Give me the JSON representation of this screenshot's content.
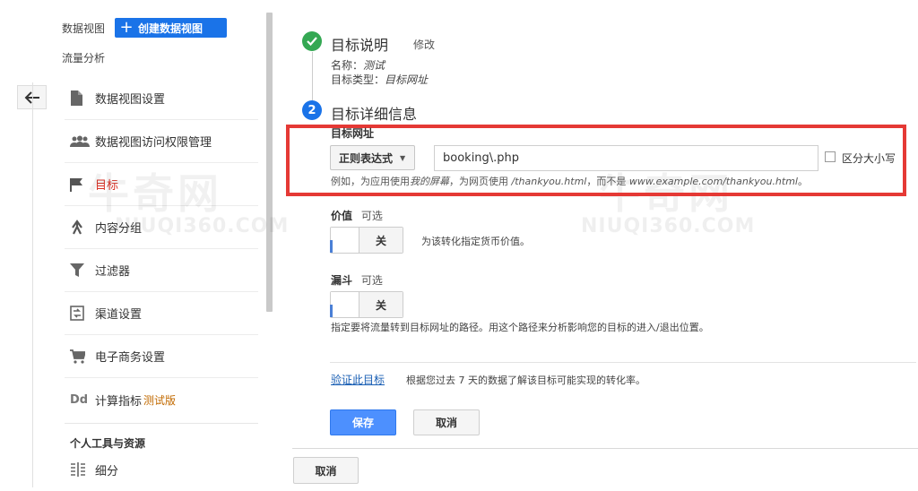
{
  "sidebar": {
    "view_label": "数据视图",
    "create_view_button": "创建数据视图",
    "section_title": "流量分析",
    "items": [
      {
        "label": "数据视图设置"
      },
      {
        "label": "数据视图访问权限管理"
      },
      {
        "label": "目标"
      },
      {
        "label": "内容分组"
      },
      {
        "label": "过滤器"
      },
      {
        "label": "渠道设置"
      },
      {
        "label": "电子商务设置"
      },
      {
        "label": "计算指标",
        "badge": "测试版"
      }
    ],
    "personal_section": "个人工具与资源",
    "segments_label": "细分",
    "accent": "#1a73e8",
    "active_color": "#d93025"
  },
  "goal_description": {
    "title": "目标说明",
    "edit_link": "修改",
    "name_label": "名称：",
    "name_value": "测试",
    "type_label": "目标类型：",
    "type_value": "目标网址"
  },
  "goal_details": {
    "step_number": "2",
    "title": "目标详细信息",
    "destination_label": "目标网址",
    "match_type": "正则表达式",
    "destination_value": "booking\\.php",
    "case_sensitive_label": "区分大小写",
    "example_prefix": "例如，为应用使用",
    "example_app": "我的屏幕",
    "example_mid": "，为网页使用 ",
    "example_page": "/thankyou.html",
    "example_mid2": "，而不是 ",
    "example_full": "www.example.com/thankyou.html",
    "example_end": "。",
    "value_label": "价值",
    "value_optional": "可选",
    "value_toggle": "关",
    "value_hint": "为该转化指定货币价值。",
    "funnel_label": "漏斗",
    "funnel_optional": "可选",
    "funnel_toggle": "关",
    "funnel_hint": "指定要将流量转到目标网址的路径。用这个路径来分析影响您的目标的进入/退出位置。",
    "verify_link": "验证此目标",
    "verify_hint": "根据您过去 7 天的数据了解该目标可能实现的转化率。",
    "save_button": "保存",
    "cancel_button": "取消"
  },
  "footer_cancel": "取消",
  "watermark": {
    "text": "牛奇网",
    "sub": "NIUQI360.COM"
  },
  "colors": {
    "check_green": "#34a853",
    "step_blue": "#1a73e8",
    "highlight_red": "#e53935",
    "link_blue": "#1a5fb4"
  }
}
